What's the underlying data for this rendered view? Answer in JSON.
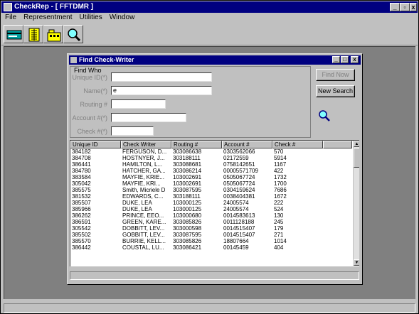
{
  "app": {
    "title": "CheckRep - [ FFTDMR ]",
    "menu": [
      "File",
      "Representment",
      "Utilities",
      "Window"
    ],
    "caption_buttons": {
      "minimize": "_",
      "restore": "▫",
      "close": "x"
    },
    "toolbar_icons": [
      "card-icon",
      "ledger-icon",
      "folder-icon",
      "magnifier-icon"
    ]
  },
  "child": {
    "title": "Find Check-Writer",
    "caption_buttons": {
      "minimize": "_",
      "maximize": "□",
      "close": "x"
    },
    "group_label": "Find Who",
    "fields": [
      {
        "label": "Unique ID(*)",
        "value": ""
      },
      {
        "label": "Name(*)",
        "value": "e"
      },
      {
        "label": "Routing #",
        "value": ""
      },
      {
        "label": "Account #(*)",
        "value": ""
      },
      {
        "label": "Check #(*)",
        "value": ""
      }
    ],
    "buttons": {
      "find_now": "Find Now",
      "new_search": "New Search"
    },
    "grid": {
      "columns": [
        "Unique ID",
        "Check Writer",
        "Routing #",
        "Account #",
        "Check #"
      ],
      "rows": [
        [
          "384182",
          "FERGUSON, D...",
          "303086638",
          "0303562066",
          "570"
        ],
        [
          "384708",
          "HOSTNYER, J...",
          "303188111",
          "02172559",
          "5914"
        ],
        [
          "386441",
          "HAMILTON, L...",
          "303088681",
          "0758142651",
          "1167"
        ],
        [
          "384780",
          "HATCHER, GA...",
          "303086214",
          "00005571709",
          "422"
        ],
        [
          "383584",
          "MAYFIE, KRIE...",
          "103002691",
          "0505067724",
          "1732"
        ],
        [
          "305042",
          "MAYFIE, KRI...",
          "103002691",
          "0505067724",
          "1700"
        ],
        [
          "385575",
          "Smith, Micriele D",
          "303087595",
          "0304159624",
          "7686"
        ],
        [
          "381532",
          "EDWARDS, C...",
          "303188111",
          "0038404381",
          "1672"
        ],
        [
          "385507",
          "DUKE, LEA",
          "103000125",
          "24005574",
          "222"
        ],
        [
          "385966",
          "DUKE, LEA",
          "103000125",
          "24005574",
          "524"
        ],
        [
          "386262",
          "PRINCE, EEO...",
          "103000680",
          "0014583613",
          "130"
        ],
        [
          "386591",
          "GREEN, KARE...",
          "303085826",
          "0011128188",
          "245"
        ],
        [
          "305542",
          "DOBBITT, LEV...",
          "303000598",
          "0014515407",
          "179"
        ],
        [
          "385502",
          "GOBBITT, LEV...",
          "303087595",
          "0014515407",
          "271"
        ],
        [
          "385570",
          "BURRIE, KELL...",
          "303085826",
          "18807664",
          "1014"
        ],
        [
          "386442",
          "COUSTAL, LU...",
          "303086421",
          "00145459",
          "404"
        ]
      ]
    }
  },
  "colors": {
    "titlebar": "#000080",
    "face": "#c0c0c0",
    "workspace": "#808080"
  }
}
